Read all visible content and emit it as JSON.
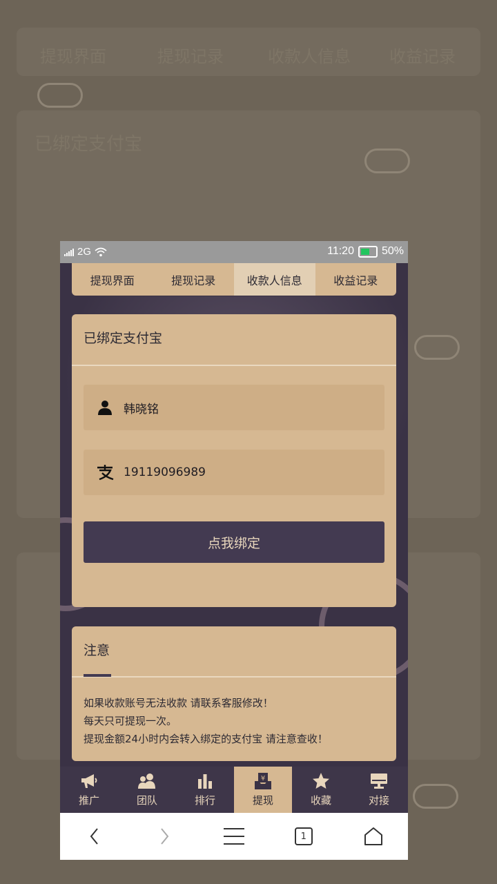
{
  "background": {
    "tabs": [
      "提现界面",
      "提现记录",
      "收款人信息",
      "收益记录"
    ],
    "card_title": "已绑定支付宝"
  },
  "status_bar": {
    "network": "2G",
    "time": "11:20",
    "battery": "50%"
  },
  "tabs": [
    {
      "label": "提现界面",
      "active": false
    },
    {
      "label": "提现记录",
      "active": false
    },
    {
      "label": "收款人信息",
      "active": true
    },
    {
      "label": "收益记录",
      "active": false
    }
  ],
  "bound_card": {
    "title": "已绑定支付宝",
    "name_value": "韩晓铭",
    "account_value": "19119096989",
    "button_label": "点我绑定"
  },
  "notice": {
    "title": "注意",
    "lines": [
      "如果收款账号无法收款 请联系客服修改！",
      "每天只可提现一次。",
      "提现金额24小时内会转入绑定的支付宝 请注意查收！"
    ]
  },
  "bottom_nav": [
    {
      "label": "推广",
      "icon": "megaphone-icon",
      "active": false
    },
    {
      "label": "团队",
      "icon": "team-icon",
      "active": false
    },
    {
      "label": "排行",
      "icon": "bar-chart-icon",
      "active": false
    },
    {
      "label": "提现",
      "icon": "withdraw-icon",
      "active": true
    },
    {
      "label": "收藏",
      "icon": "star-icon",
      "active": false
    },
    {
      "label": "对接",
      "icon": "monitor-icon",
      "active": false
    }
  ],
  "browser_bar": {
    "tab_count": "1"
  },
  "colors": {
    "accent": "#d6b892",
    "dark": "#3a3245",
    "button": "#433a51"
  }
}
